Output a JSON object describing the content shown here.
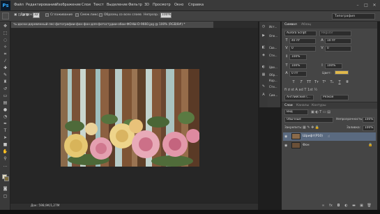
{
  "app": {
    "logo": "Ps"
  },
  "menu": [
    "Файл",
    "Редактирование",
    "Изображение",
    "Слои",
    "Текст",
    "Выделение",
    "Фильтр",
    "3D",
    "Просмотр",
    "Окно",
    "Справка"
  ],
  "options": {
    "density_label": "Допуск:",
    "density_value": "32",
    "antialias_label": "Сглаживание",
    "contiguous_label": "Смеж.пикс.",
    "all_layers_label": "Образец со всех слоев",
    "opacity_label": "Непрозр.:",
    "opacity_value": "100%",
    "workspace": "Типография"
  },
  "document": {
    "tab_title": "ть-доски-деревянный-лес-фотографии-фон-фон-для-фотостудии-обои-ФОНЫ-D-9660.jpg @ 100% (RGB/8#) *",
    "status": "Док: 598,9К/1,27М"
  },
  "right_icons": {
    "labels": [
      "Ист...",
      "Опе...",
      "Сва...",
      "Сти...",
      "Цве...",
      "Обр...",
      "Кор...",
      "Сти...",
      "Сим..."
    ]
  },
  "character": {
    "tab_character": "Символ",
    "tab_paragraph": "Абзац",
    "font_family": "Aurora Script",
    "font_style": "Regular",
    "size": "40 пт",
    "leading": "10 пт",
    "kerning": "0",
    "tracking": "0",
    "scale_v": "100%",
    "scale_h": "100%",
    "baseline": "0 пт",
    "color_label": "Цвет:",
    "color_swatch": "#e0b84a",
    "language": "Английский (...",
    "antialias": "Резкое",
    "buttons": [
      "T",
      "T",
      "TT",
      "Tт",
      "T¹",
      "T₁",
      "T",
      "T"
    ]
  },
  "layers": {
    "tabs": [
      "Слои",
      "Каналы",
      "Контуры"
    ],
    "kind_filter": "Вид",
    "blend_mode": "Обычные",
    "opacity_label": "Непрозрачность:",
    "opacity_value": "100%",
    "lock_label": "Закрепить:",
    "fill_label": "Заливка:",
    "fill_value": "100%",
    "items": [
      {
        "name": "Шрифт(Р10)",
        "selected": true
      },
      {
        "name": "Фон",
        "selected": false
      }
    ]
  },
  "colors": {
    "accent": "#31a8ff",
    "selected_layer": "#5a6a80"
  }
}
